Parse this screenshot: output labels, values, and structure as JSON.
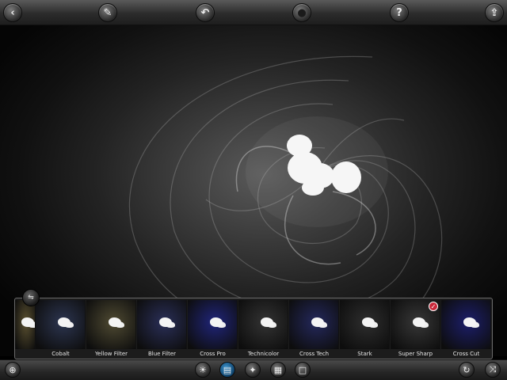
{
  "toolbar": {
    "buttons": [
      {
        "name": "back-button",
        "icon": "chevron-left-icon",
        "glyph": "‹"
      },
      {
        "name": "tools-button",
        "icon": "wrench-icon",
        "glyph": "✎"
      },
      {
        "name": "undo-button",
        "icon": "undo-arrow-icon",
        "glyph": "↶"
      },
      {
        "name": "mask-button",
        "icon": "dark-circle-icon",
        "glyph": "●"
      },
      {
        "name": "help-button",
        "icon": "question-icon",
        "glyph": "?"
      },
      {
        "name": "share-button",
        "icon": "share-icon",
        "glyph": "⇪"
      }
    ]
  },
  "filters": [
    {
      "label": "",
      "tint": "#5a5030"
    },
    {
      "label": "Cobalt",
      "tint": "#2c3550"
    },
    {
      "label": "Yellow Filter",
      "tint": "#4f4a32"
    },
    {
      "label": "Blue Filter",
      "tint": "#2a2f58"
    },
    {
      "label": "Cross Pro",
      "tint": "#20257a"
    },
    {
      "label": "Technicolor",
      "tint": "#333333"
    },
    {
      "label": "Cross Tech",
      "tint": "#24285c"
    },
    {
      "label": "Stark",
      "tint": "#2e2e2e"
    },
    {
      "label": "Super Sharp",
      "tint": "#373737"
    },
    {
      "label": "Cross Cut",
      "tint": "#1c1e6a"
    }
  ],
  "selected_filter": "Super Sharp",
  "strip_handle_icon": "sliders-icon",
  "check_icon": "checkmark-icon",
  "bottom": {
    "left": {
      "name": "grid-button",
      "icon": "globe-grid-icon",
      "glyph": "⊕"
    },
    "center": [
      {
        "name": "adjust-button",
        "icon": "sun-icon",
        "glyph": "☀",
        "active": false
      },
      {
        "name": "filters-button",
        "icon": "filters-icon",
        "glyph": "▤",
        "active": true
      },
      {
        "name": "effects-button",
        "icon": "stars-icon",
        "glyph": "✦",
        "active": false
      },
      {
        "name": "texture-button",
        "icon": "checker-icon",
        "glyph": "▦",
        "active": false
      },
      {
        "name": "frame-button",
        "icon": "square-frame-icon",
        "glyph": "□",
        "active": false
      }
    ],
    "right": [
      {
        "name": "reset-button",
        "icon": "refresh-icon",
        "glyph": "↻"
      },
      {
        "name": "random-button",
        "icon": "shuffle-icon",
        "glyph": "⤨"
      }
    ]
  }
}
